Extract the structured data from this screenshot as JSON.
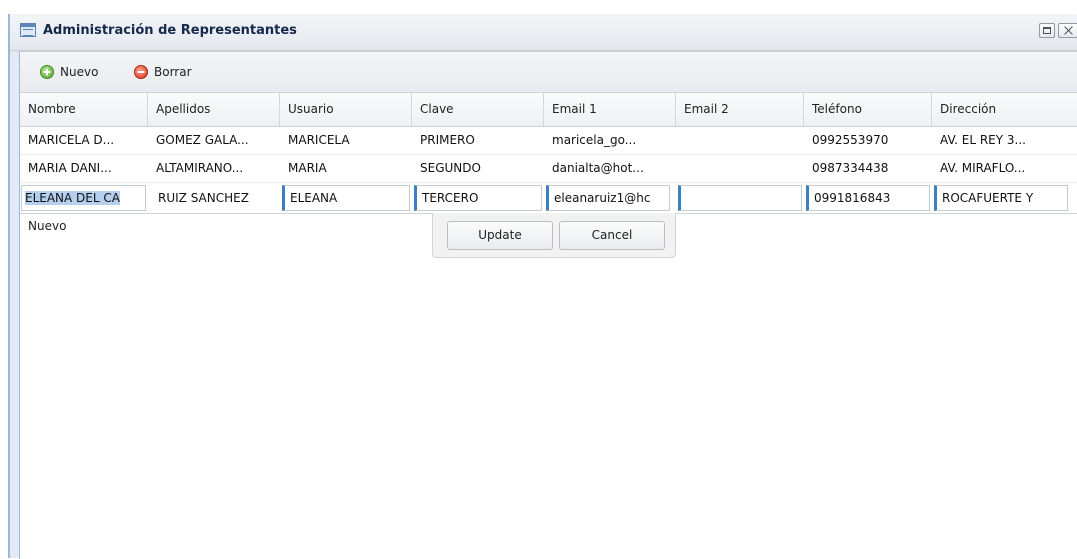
{
  "window": {
    "title": "Administración de Representantes"
  },
  "toolbar": {
    "add_label": "Nuevo",
    "delete_label": "Borrar"
  },
  "columns": [
    "Nombre",
    "Apellidos",
    "Usuario",
    "Clave",
    "Email 1",
    "Email 2",
    "Teléfono",
    "Dirección"
  ],
  "rows": [
    [
      "MARICELA D...",
      "GOMEZ GALA...",
      "MARICELA",
      "PRIMERO",
      "maricela_go...",
      "",
      "0992553970",
      "AV. EL REY 3..."
    ],
    [
      "MARIA DANI...",
      "ALTAMIRANO...",
      "MARIA",
      "SEGUNDO",
      "danialta@hot...",
      "",
      "0987334438",
      "AV. MIRAFLO..."
    ]
  ],
  "edit_row": [
    "ELEANA DEL CA",
    "RUIZ SANCHEZ",
    "ELEANA",
    "TERCERO",
    "eleanaruiz1@hc",
    "",
    "0991816843",
    "ROCAFUERTE Y"
  ],
  "editor": {
    "update_label": "Update",
    "cancel_label": "Cancel"
  },
  "new_row_label": "Nuevo"
}
